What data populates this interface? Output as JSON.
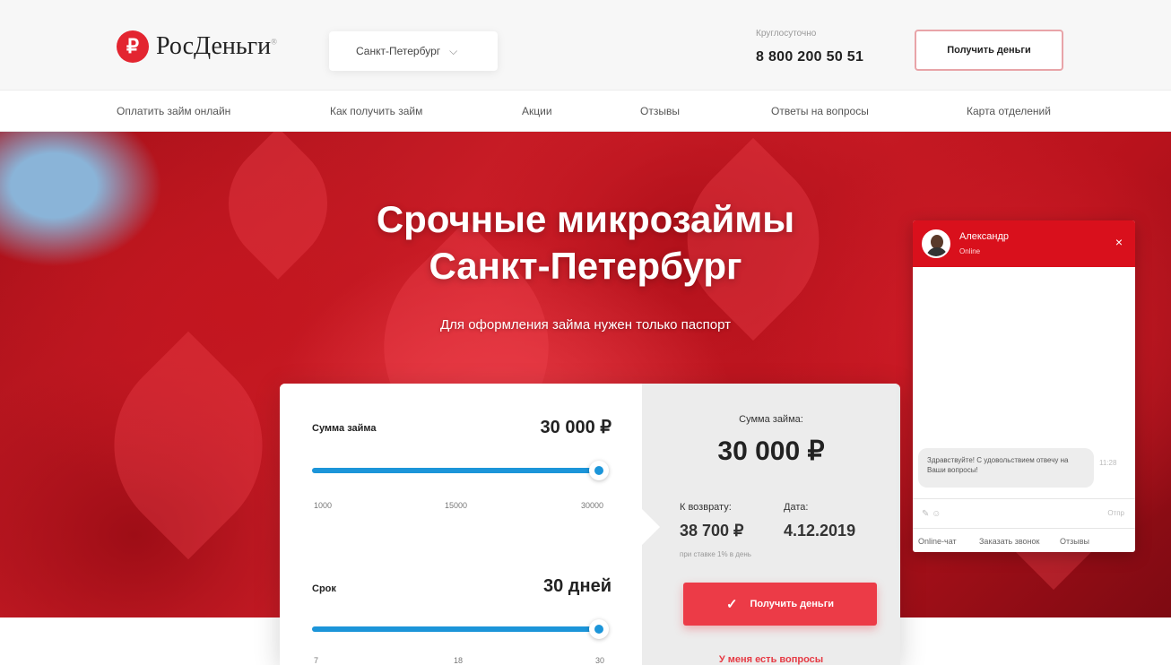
{
  "header": {
    "logo_symbol": "₽",
    "logo_text": "РосДеньги",
    "logo_mark": "®",
    "city": "Санкт-Петербург",
    "phone_caption": "Круглосуточно",
    "phone": "8 800 200 50 51",
    "cta_label": "Получить деньги"
  },
  "nav": {
    "items": [
      "Оплатить займ онлайн",
      "Как получить займ",
      "Акции",
      "Отзывы",
      "Ответы на вопросы",
      "Карта отделений"
    ]
  },
  "hero": {
    "title_line1": "Срочные микрозаймы",
    "title_line2": "Санкт-Петербург",
    "subtitle": "Для оформления займа нужен только паспорт"
  },
  "calculator": {
    "amount_label": "Сумма займа",
    "amount_value": "30 000 ₽",
    "amount_slider_fraction": 1.0,
    "amount_ticks": [
      "1000",
      "15000",
      "30000"
    ],
    "term_label": "Срок",
    "term_value": "30 дней",
    "term_slider_fraction": 1.0,
    "term_ticks": [
      "7",
      "18",
      "30"
    ],
    "summary_label": "Сумма займа:",
    "summary_value": "30 000 ₽",
    "return_label": "К возврату:",
    "return_value": "38 700 ₽",
    "date_label": "Дата:",
    "date_value": "4.12.2019",
    "rate_note": "при ставке 1% в день",
    "submit_label": "Получить деньги",
    "questions_link": "У меня есть вопросы"
  },
  "chat": {
    "agent_name": "Александр",
    "agent_status": "Online",
    "message": "Здравствуйте! С удовольствием отвечу на Ваши вопросы!",
    "message_time": "11:28",
    "send_label": "Отпр",
    "tabs": [
      "Online-чат",
      "Заказать звонок",
      "Отзывы"
    ]
  },
  "colors": {
    "brand_red": "#e32530",
    "slider_blue": "#1c95d9",
    "button_red": "#ec3b47"
  }
}
